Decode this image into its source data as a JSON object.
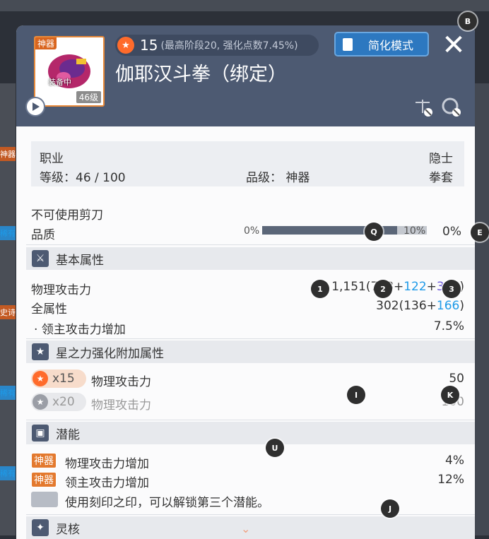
{
  "background": {
    "side_tags": [
      "神器",
      "稀有",
      "史诗",
      "稀有",
      "稀有"
    ]
  },
  "header": {
    "item_badge": "神器",
    "equipped_label": "装备中",
    "item_level": "46级",
    "star_count": "15",
    "star_detail": "(最高阶段20, 强化点数7.45%)",
    "title": "伽耶汉斗拳（绑定）",
    "simple_mode_label": "简化模式",
    "close_glyph": "✕"
  },
  "info": {
    "job_label": "职业",
    "job_value": "隐士",
    "level_text": "等级：46 / 100",
    "grade_text": "品级：  神器",
    "weapon_type": "拳套"
  },
  "scissors_text": "不可使用剪刀",
  "quality": {
    "label": "品质",
    "bar_min": "0%",
    "bar_max": "10%",
    "value": "0%",
    "fill_fraction": 0.82
  },
  "basic": {
    "title": "基本属性",
    "attack_label": "物理攻击力",
    "attack_total": "1,151(7",
    "attack_hidden": "2",
    "attack_base_tail": "8+",
    "attack_blue": "122",
    "attack_plus": "+",
    "attack_purple": "301",
    "attack_close": ")",
    "allstat_label": "全属性",
    "allstat_base": "302(136+",
    "allstat_blue": "166",
    "allstat_close": ")",
    "boss_label": "·  领主攻击力增加",
    "boss_value": "7.5%"
  },
  "star_force": {
    "title": "星之力强化附加属性",
    "row1_count": "x15",
    "row1_label": "物理攻击力",
    "row1_value": "50",
    "row2_count": "x20",
    "row2_label": "物理攻击力",
    "row2_value": "100"
  },
  "potential": {
    "title": "潜能",
    "rows": [
      {
        "tag": "神器",
        "label": "物理攻击力增加",
        "value": "4%"
      },
      {
        "tag": "神器",
        "label": "领主攻击力增加",
        "value": "12%"
      }
    ],
    "unlock_text": "使用刻印之印，可以解锁第三个潜能。"
  },
  "core": {
    "title": "灵核"
  },
  "markers": [
    "B",
    "Q",
    "E",
    "1",
    "2",
    "3",
    "I",
    "K",
    "U",
    "J"
  ],
  "colors": {
    "header_bg": "#4d5a72",
    "accent_orange": "#e3792e",
    "bonus_blue": "#1e9ae8",
    "bonus_purple": "#6a55d8",
    "star_active": "#ff6b2b"
  }
}
